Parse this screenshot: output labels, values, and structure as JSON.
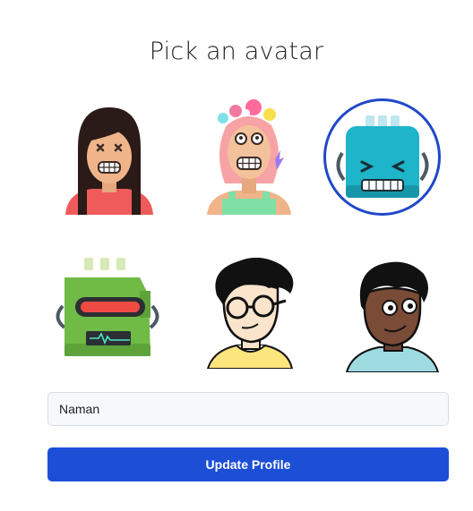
{
  "page": {
    "title": "Pick an avatar"
  },
  "avatars": [
    {
      "name": "girl-dark-hair"
    },
    {
      "name": "girl-flower-crown"
    },
    {
      "name": "blue-robot",
      "selected": true
    },
    {
      "name": "green-robot"
    },
    {
      "name": "boy-glasses"
    },
    {
      "name": "boy-curly-hair"
    }
  ],
  "form": {
    "name_value": "Naman",
    "submit_label": "Update Profile"
  },
  "colors": {
    "accent": "#1c4fd6",
    "selection_ring": "#2048c8"
  }
}
